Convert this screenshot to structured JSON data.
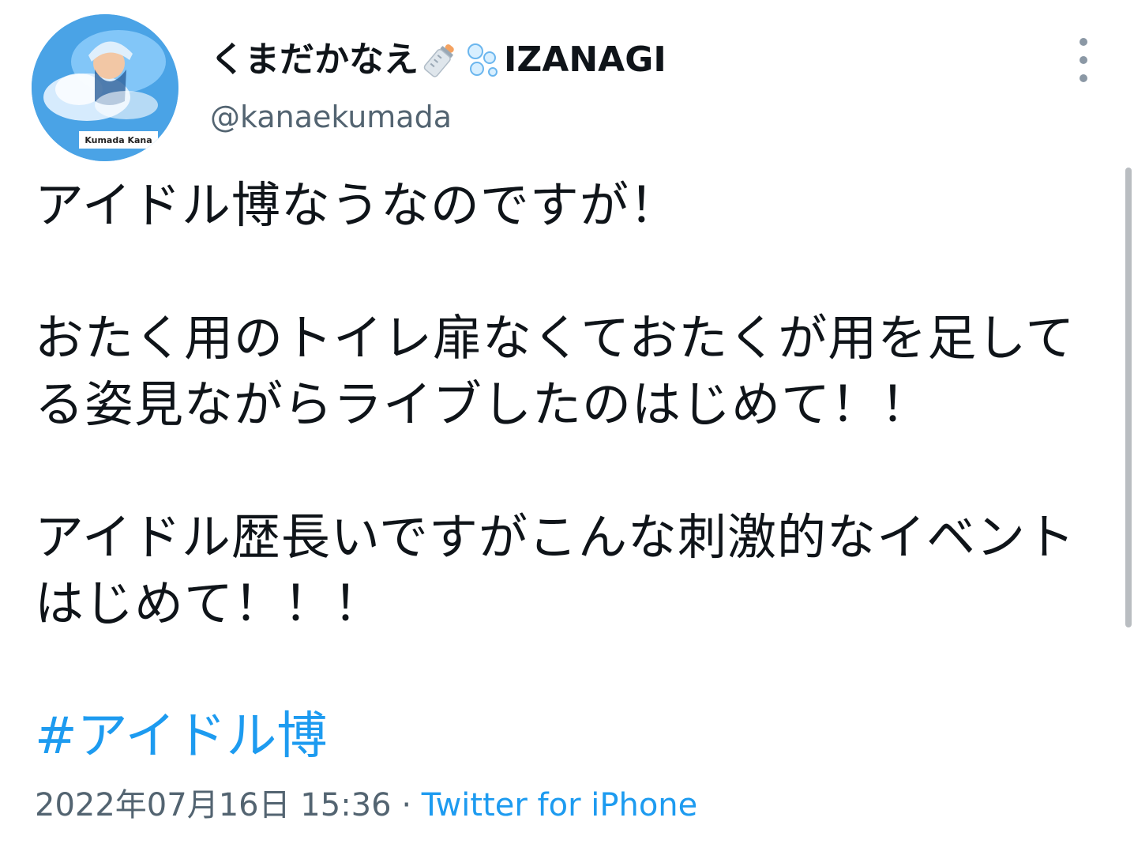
{
  "user": {
    "display_name": "くまだかなえ",
    "display_name_suffix": "IZANAGI",
    "emojis": [
      "baby-bottle-emoji",
      "bubbles-emoji"
    ],
    "handle": "@kanaekumada",
    "avatar_caption": "Kumada Kana"
  },
  "tweet": {
    "text": "アイドル博なうなのですが！\n\nおたく用のトイレ扉なくておたくが用を足してる姿見ながらライブしたのはじめて！！\n\nアイドル歴長いですがこんな刺激的なイベントはじめて！！！",
    "hashtag": "#アイドル博",
    "timestamp": "2022年07月16日 15:36",
    "separator": "·",
    "source": "Twitter for iPhone"
  },
  "colors": {
    "link": "#1d9bf0",
    "secondary_text": "#536471",
    "primary_text": "#0f1419"
  }
}
